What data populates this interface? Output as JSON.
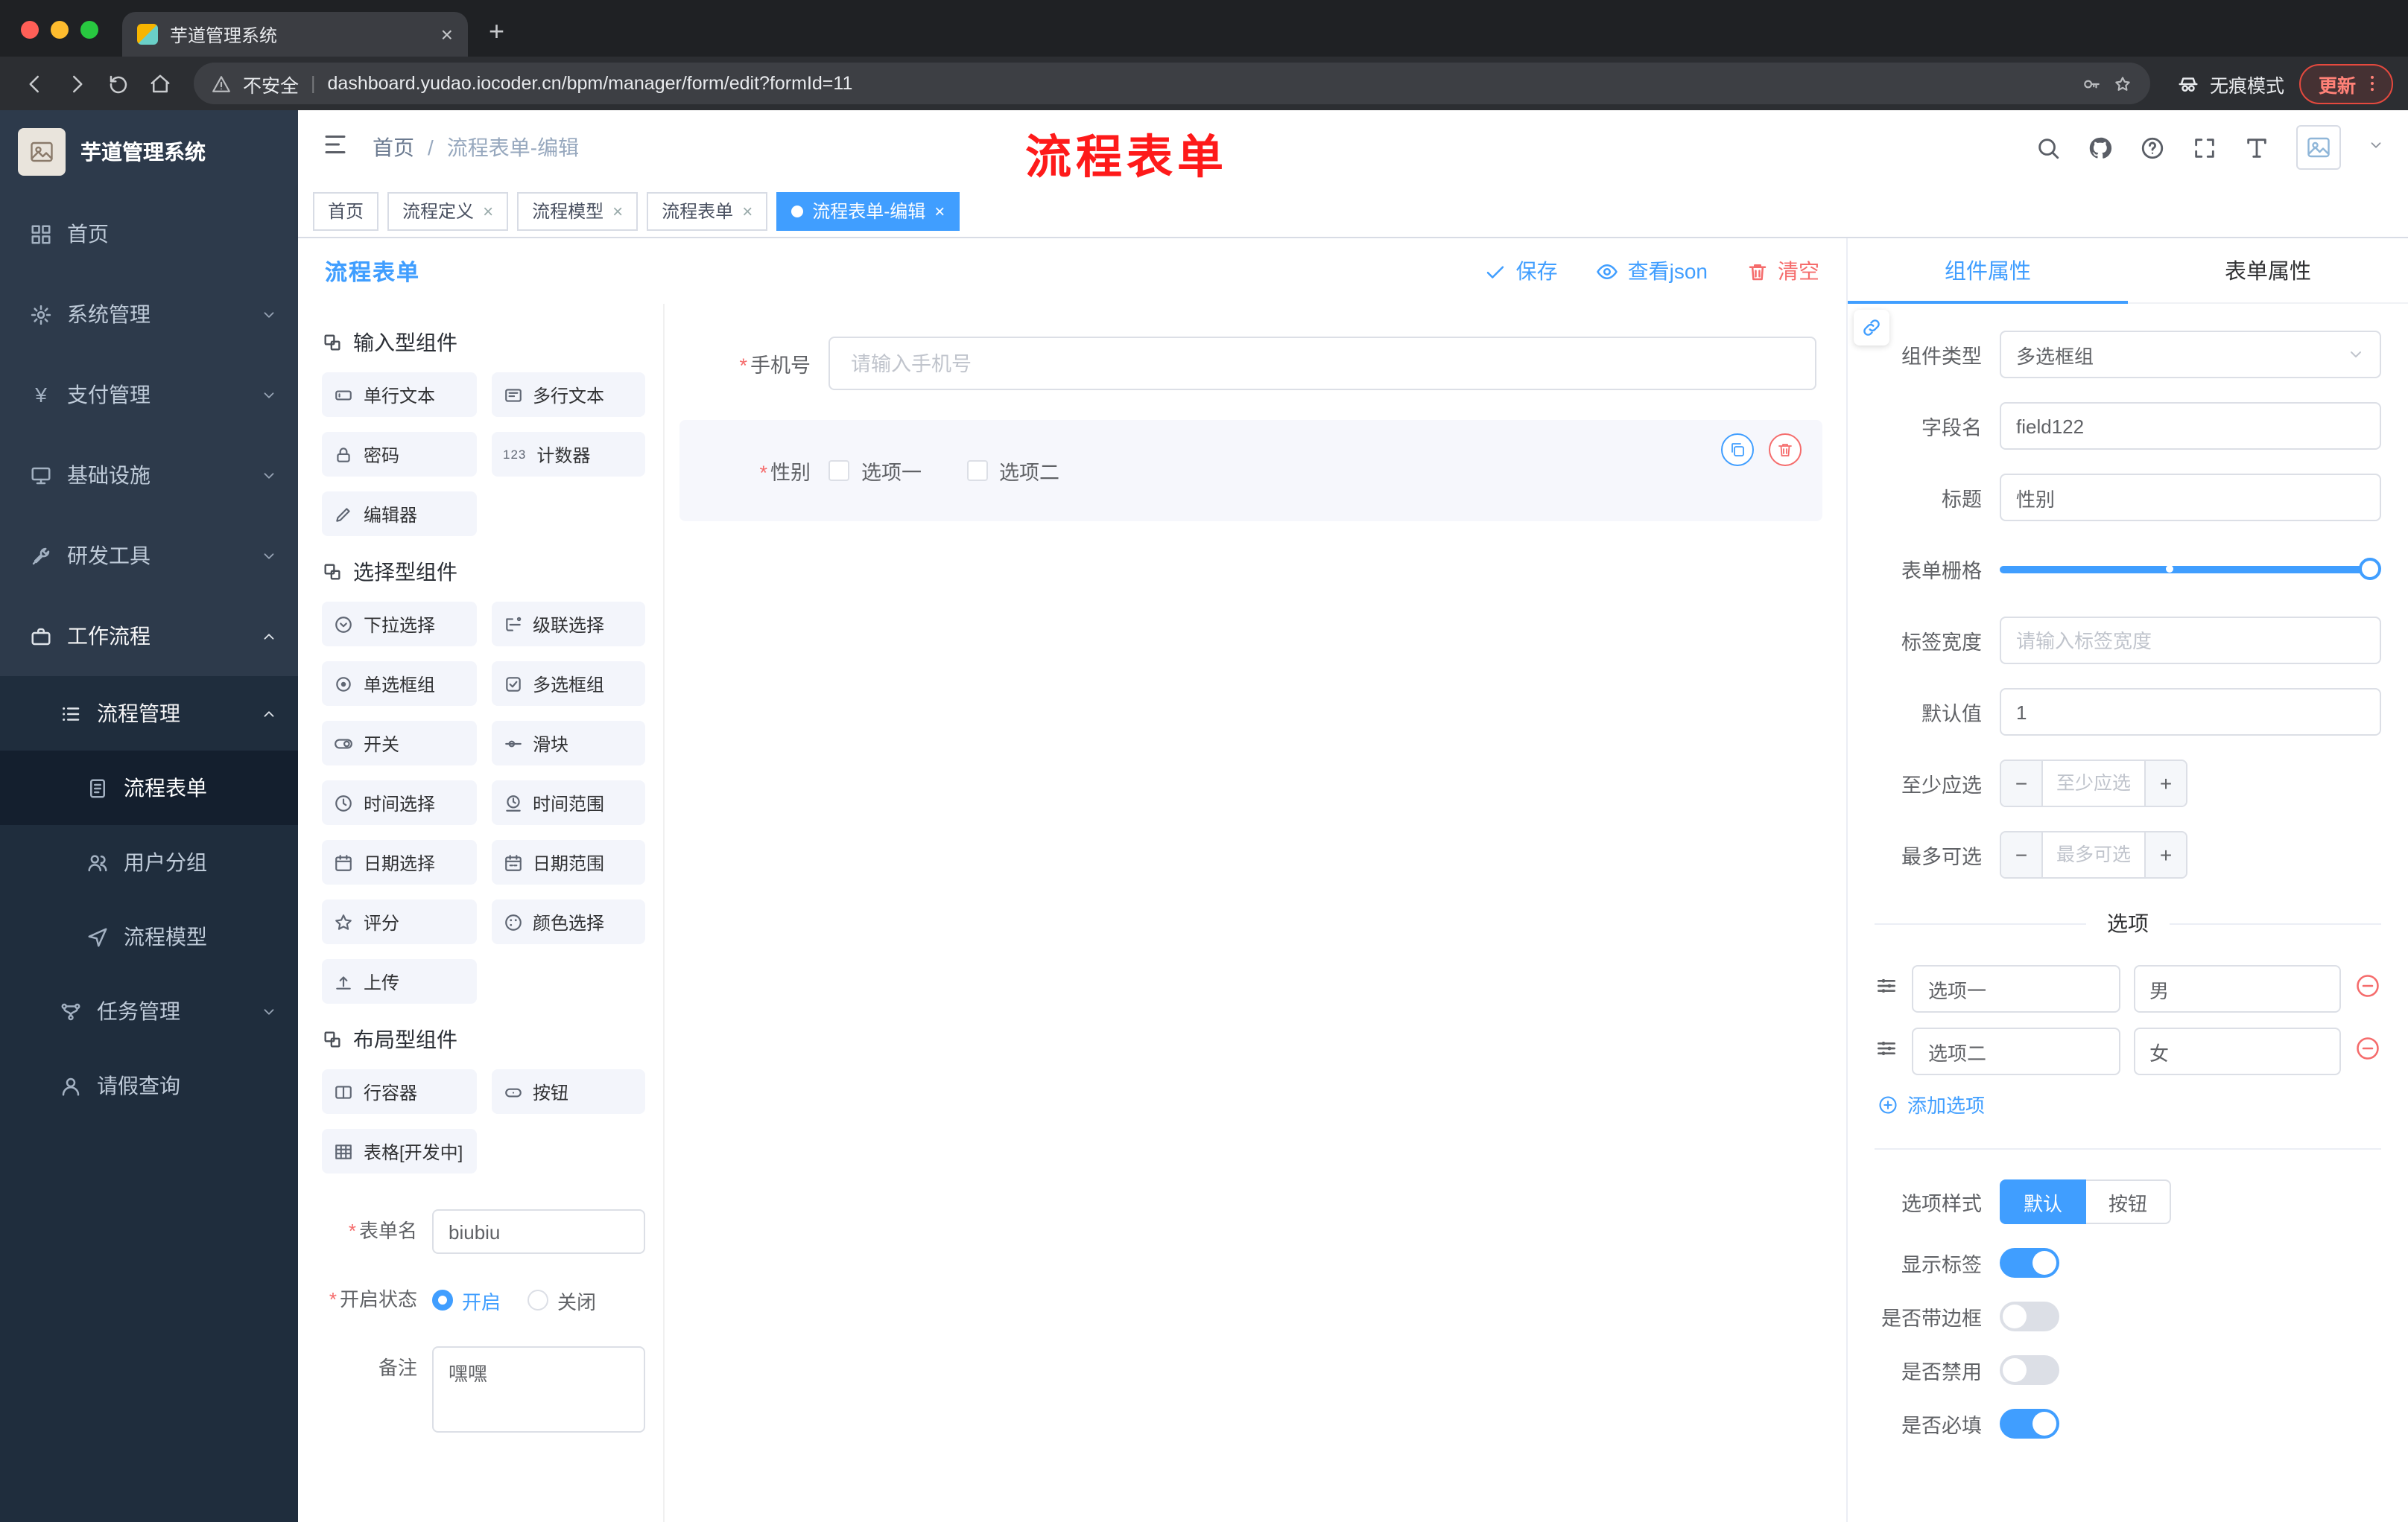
{
  "colors": {
    "accent": "#409eff",
    "danger": "#f56c6c",
    "annotation": "#fe1a1a",
    "sidebar_bg": "#2d3a4b",
    "submenu_bg": "#1f2d3d"
  },
  "glyphs": {
    "asterisk": "*",
    "slash": "/",
    "divider": "|",
    "close": "×",
    "plus": "+",
    "minus": "−",
    "yen": "¥"
  },
  "browser": {
    "tab_title": "芋道管理系统",
    "security_label": "不安全",
    "url": "dashboard.yudao.iocoder.cn/bpm/manager/form/edit?formId=11",
    "incognito_label": "无痕模式",
    "update_label": "更新"
  },
  "sidebar": {
    "logo_title": "芋道管理系统",
    "items": [
      {
        "label": "首页"
      },
      {
        "label": "系统管理"
      },
      {
        "label": "支付管理"
      },
      {
        "label": "基础设施"
      },
      {
        "label": "研发工具"
      },
      {
        "label": "工作流程"
      },
      {
        "label": "流程管理"
      },
      {
        "label": "流程表单"
      },
      {
        "label": "用户分组"
      },
      {
        "label": "流程模型"
      },
      {
        "label": "任务管理"
      },
      {
        "label": "请假查询"
      }
    ]
  },
  "header": {
    "breadcrumb": [
      "首页",
      "流程表单-编辑"
    ],
    "annotation": "流程表单"
  },
  "tags": [
    {
      "label": "首页"
    },
    {
      "label": "流程定义"
    },
    {
      "label": "流程模型"
    },
    {
      "label": "流程表单"
    },
    {
      "label": "流程表单-编辑"
    }
  ],
  "designer": {
    "title": "流程表单",
    "actions": {
      "save": "保存",
      "view_json": "查看json",
      "clear": "清空"
    },
    "palette": {
      "groups": [
        {
          "title": "输入型组件",
          "items": [
            "单行文本",
            "多行文本",
            "密码",
            "计数器",
            "编辑器"
          ]
        },
        {
          "title": "选择型组件",
          "items": [
            "下拉选择",
            "级联选择",
            "单选框组",
            "多选框组",
            "开关",
            "滑块",
            "时间选择",
            "时间范围",
            "日期选择",
            "日期范围",
            "评分",
            "颜色选择",
            "上传"
          ]
        },
        {
          "title": "布局型组件",
          "items": [
            "行容器",
            "按钮",
            "表格[开发中]"
          ]
        }
      ]
    },
    "meta": {
      "form_name_label": "表单名",
      "form_name_value": "biubiu",
      "status_label": "开启状态",
      "status_on": "开启",
      "status_off": "关闭",
      "remark_label": "备注",
      "remark_value": "嘿嘿"
    },
    "canvas": {
      "phone_label": "手机号",
      "phone_placeholder": "请输入手机号",
      "gender_label": "性别",
      "gender_options": [
        "选项一",
        "选项二"
      ]
    }
  },
  "props": {
    "tabs": {
      "component": "组件属性",
      "form": "表单属性"
    },
    "rows": {
      "type_label": "组件类型",
      "type_value": "多选框组",
      "field_label": "字段名",
      "field_value": "field122",
      "title_label": "标题",
      "title_value": "性别",
      "grid_label": "表单栅格",
      "label_width_label": "标签宽度",
      "label_width_placeholder": "请输入标签宽度",
      "default_label": "默认值",
      "default_value": "1",
      "min_label": "至少应选",
      "min_placeholder": "至少应选",
      "max_label": "最多可选",
      "max_placeholder": "最多可选"
    },
    "options": {
      "divider": "选项",
      "rows": [
        {
          "label": "选项一",
          "value": "男"
        },
        {
          "label": "选项二",
          "value": "女"
        }
      ],
      "add": "添加选项"
    },
    "style": {
      "label": "选项样式",
      "default": "默认",
      "button": "按钮"
    },
    "switches": [
      {
        "label": "显示标签",
        "on": true
      },
      {
        "label": "是否带边框",
        "on": false
      },
      {
        "label": "是否禁用",
        "on": false
      },
      {
        "label": "是否必填",
        "on": true
      }
    ]
  }
}
